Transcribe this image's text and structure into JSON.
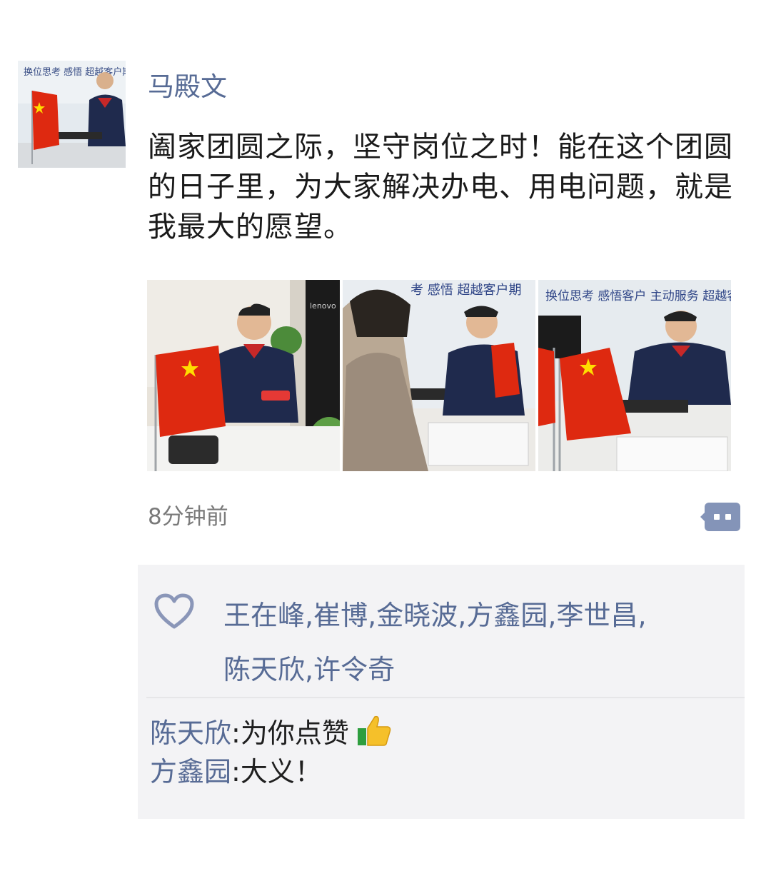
{
  "post": {
    "author": "马殿文",
    "text": "阖家团圆之际，坚守岗位之时！能在这个团圆的日子里，为大家解决办电、用电问题，就是我最大的愿望。",
    "time": "8分钟前",
    "images": [
      {
        "name": "photo-1",
        "text": "lenovo"
      },
      {
        "name": "photo-2",
        "text": "考 感悟 超越客户期"
      },
      {
        "name": "photo-3",
        "text": "换位思考 感悟客户 主动服务 超越客户期待"
      }
    ],
    "avatar_text": "换位思考 感悟 超越客户期待"
  },
  "likes": {
    "icon": "heart-outline-icon",
    "names": [
      "王在峰",
      "崔博",
      "金晓波",
      "方鑫园",
      "李世昌",
      "陈天欣",
      "许令奇"
    ]
  },
  "comments": [
    {
      "name": "陈天欣",
      "sep": ":",
      "text": "为你点赞",
      "emoji": "thumbs-up-icon"
    },
    {
      "name": "方鑫园",
      "sep": ":",
      "text": "大义！"
    }
  ],
  "colors": {
    "link": "#576b95",
    "panel": "#f3f3f5",
    "flag": "#de2910",
    "star": "#ffde00"
  }
}
